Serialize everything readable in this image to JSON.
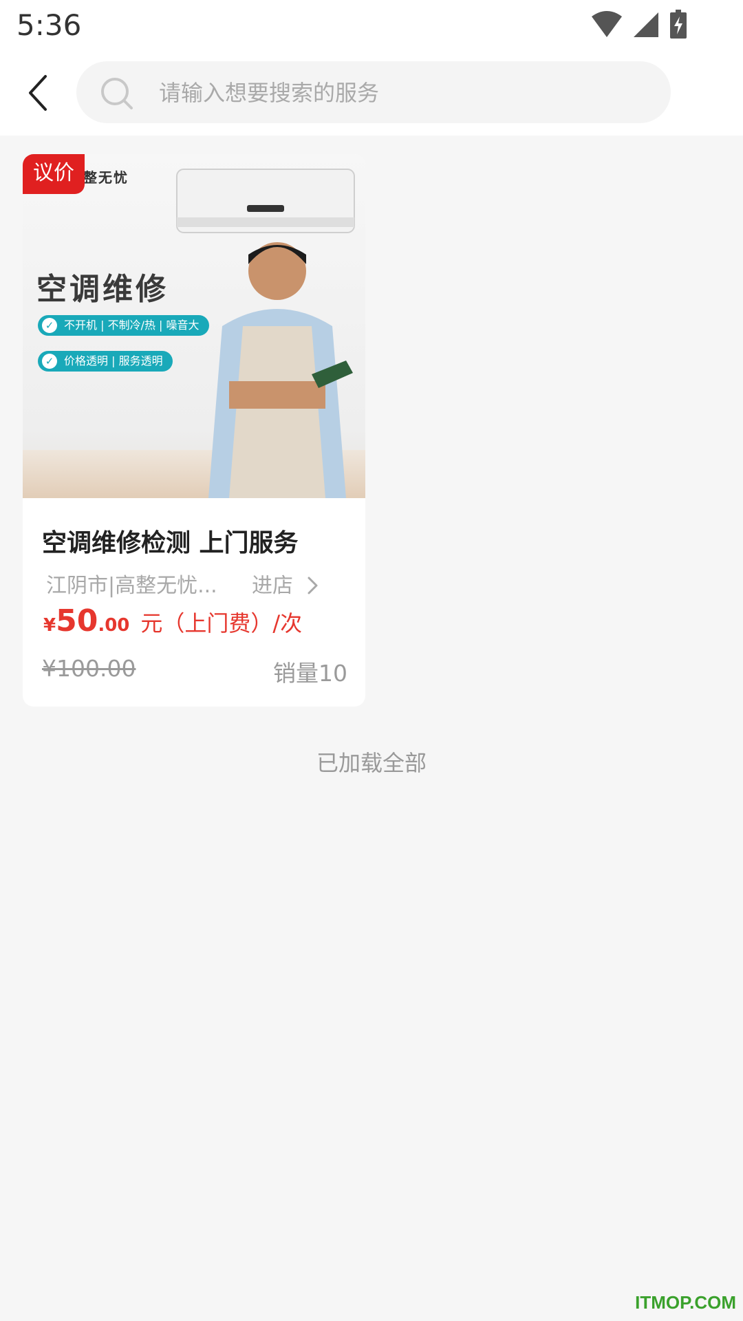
{
  "status_bar": {
    "time": "5:36",
    "icons": [
      "wifi-icon",
      "signal-icon",
      "battery-charging-icon"
    ]
  },
  "header": {
    "back_icon": "chevron-left-icon",
    "search": {
      "placeholder": "请输入想要搜索的服务",
      "value": "",
      "icon": "search-icon"
    }
  },
  "products": [
    {
      "tag": "议价",
      "image": {
        "brand": "整无忧",
        "headline": "空调维修",
        "features": [
          "不开机 | 不制冷/热 | 噪音大",
          "价格透明 | 服务透明"
        ]
      },
      "title": "空调维修检测 上门服务",
      "store": "江阴市|高整无忧...",
      "enter_store": "进店",
      "price": {
        "currency": "¥",
        "integer": "50",
        "decimal": ".00",
        "unit": "元（上门费）/次"
      },
      "original_price": "¥100.00",
      "sales": "销量10"
    }
  ],
  "footer": {
    "load_all": "已加载全部"
  },
  "watermark": "ITMOP.COM",
  "colors": {
    "accent_red": "#e6372e",
    "tag_red": "#e02020",
    "feature_teal": "#19a9b9",
    "background": "#f6f6f6"
  }
}
